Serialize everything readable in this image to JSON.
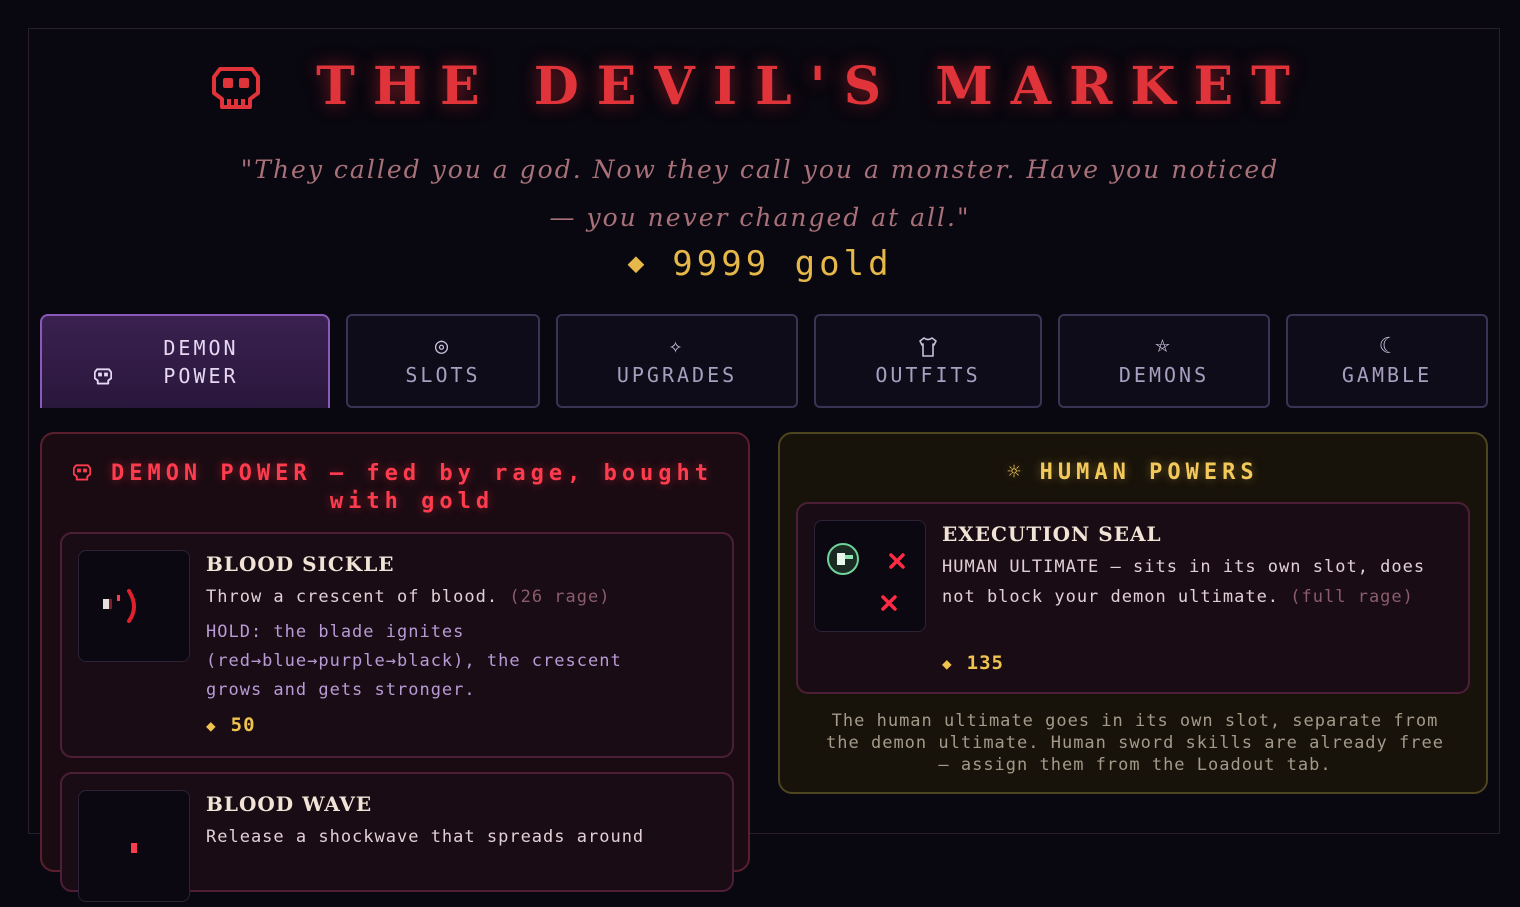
{
  "header": {
    "title": "THE DEVIL'S MARKET",
    "quote": "\"They called you a god. Now they call you a monster. Have you noticed — you never changed at all.\"",
    "gold_amount": "9999",
    "gold_unit": "gold",
    "gold_icon": "◆"
  },
  "tabs": [
    {
      "icon": "skull-icon",
      "label": "DEMON POWER",
      "active": true
    },
    {
      "icon": "target-icon",
      "glyph": "◎",
      "label": "SLOTS",
      "active": false
    },
    {
      "icon": "sparkle-icon",
      "glyph": "✧",
      "label": "UPGRADES",
      "active": false
    },
    {
      "icon": "shirt-icon",
      "label": "OUTFITS",
      "active": false
    },
    {
      "icon": "pentagram-icon",
      "glyph": "⛤",
      "label": "DEMONS",
      "active": false
    },
    {
      "icon": "moon-icon",
      "glyph": "☾",
      "label": "GAMBLE",
      "active": false
    }
  ],
  "demon_panel": {
    "title": "DEMON POWER — fed by rage, bought with gold",
    "items": [
      {
        "name": "BLOOD SICKLE",
        "desc": "Throw a crescent of blood.",
        "cost": "(26 rage)",
        "hold": "HOLD: the blade ignites (red→blue→purple→black), the crescent grows and gets stronger.",
        "price": "50"
      },
      {
        "name": "BLOOD WAVE",
        "desc": "Release a shockwave that spreads around"
      }
    ]
  },
  "human_panel": {
    "title": "HUMAN POWERS",
    "items": [
      {
        "name": "EXECUTION SEAL",
        "desc": "HUMAN ULTIMATE — sits in its own slot, does not block your demon ultimate.",
        "cost": "(full rage)",
        "price": "135"
      }
    ],
    "note": "The human ultimate goes in its own slot, separate from the demon ultimate. Human sword skills are already free — assign them from the Loadout tab."
  },
  "colors": {
    "background": "#09070f",
    "accent_red": "#e0333a",
    "gold": "#e6b84a",
    "active_tab": "#3a2150"
  }
}
